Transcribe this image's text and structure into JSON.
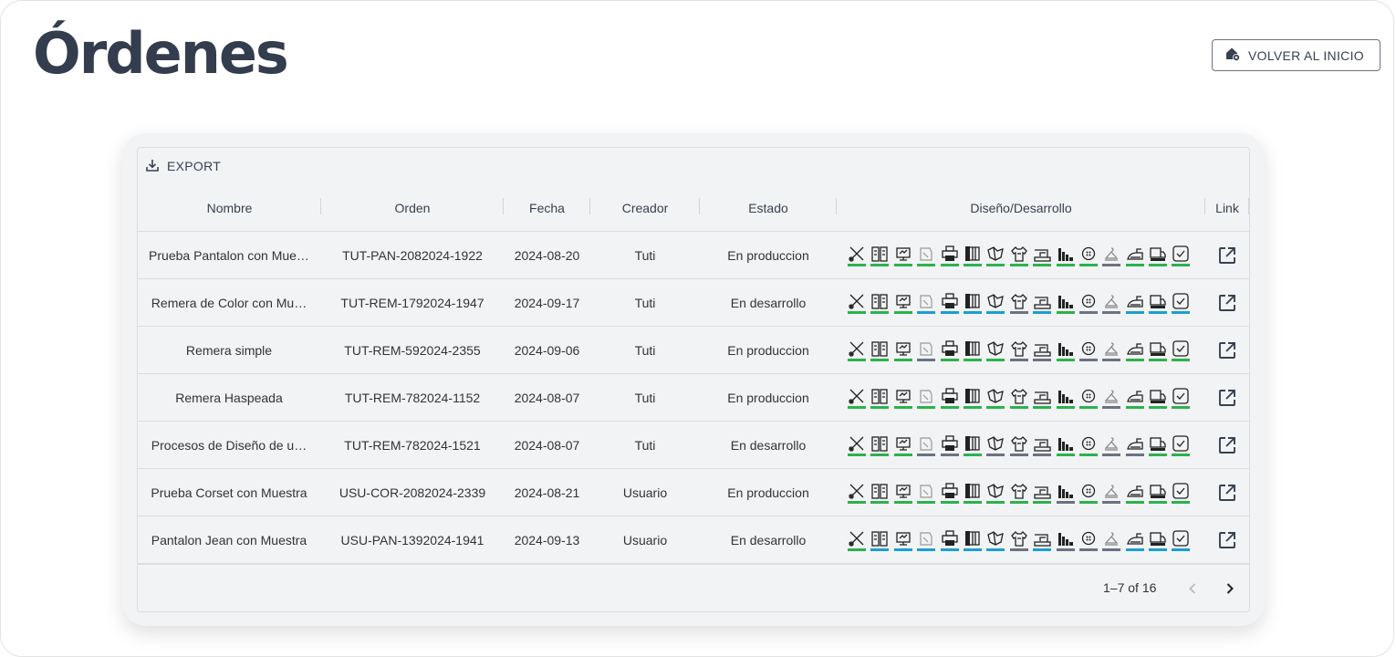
{
  "page": {
    "title": "Órdenes"
  },
  "home_button": {
    "label": "VOLVER AL INICIO",
    "icon": "home-icon"
  },
  "grid": {
    "export_label": "EXPORT",
    "columns": [
      "Nombre",
      "Orden",
      "Fecha",
      "Creador",
      "Estado",
      "Diseño/Desarrollo",
      "Link"
    ],
    "rows": [
      {
        "nombre": "Prueba Pantalon con Mue…",
        "orden": "TUT-PAN-2082024-1922",
        "fecha": "2024-08-20",
        "creador": "Tuti",
        "estado": "En produccion",
        "status": [
          "green",
          "green",
          "green",
          "green",
          "green",
          "green",
          "green",
          "green",
          "green",
          "green",
          "green",
          "grey",
          "green",
          "green",
          "green"
        ]
      },
      {
        "nombre": "Remera de Color con Mu…",
        "orden": "TUT-REM-1792024-1947",
        "fecha": "2024-09-17",
        "creador": "Tuti",
        "estado": "En desarrollo",
        "status": [
          "green",
          "green",
          "green",
          "blue",
          "blue",
          "blue",
          "blue",
          "grey",
          "blue",
          "green",
          "grey",
          "grey",
          "blue",
          "blue",
          "blue"
        ]
      },
      {
        "nombre": "Remera simple",
        "orden": "TUT-REM-592024-2355",
        "fecha": "2024-09-06",
        "creador": "Tuti",
        "estado": "En produccion",
        "status": [
          "green",
          "green",
          "green",
          "grey",
          "green",
          "green",
          "green",
          "grey",
          "grey",
          "green",
          "grey",
          "grey",
          "green",
          "green",
          "green"
        ]
      },
      {
        "nombre": "Remera Haspeada",
        "orden": "TUT-REM-782024-1152",
        "fecha": "2024-08-07",
        "creador": "Tuti",
        "estado": "En produccion",
        "status": [
          "green",
          "green",
          "green",
          "green",
          "green",
          "green",
          "green",
          "green",
          "green",
          "green",
          "green",
          "grey",
          "green",
          "green",
          "green"
        ]
      },
      {
        "nombre": "Procesos de Diseño de u…",
        "orden": "TUT-REM-782024-1521",
        "fecha": "2024-08-07",
        "creador": "Tuti",
        "estado": "En desarrollo",
        "status": [
          "green",
          "green",
          "green",
          "grey",
          "grey",
          "green",
          "grey",
          "grey",
          "grey",
          "green",
          "green",
          "grey",
          "grey",
          "green",
          "green"
        ]
      },
      {
        "nombre": "Prueba Corset con Muestra",
        "orden": "USU-COR-2082024-2339",
        "fecha": "2024-08-21",
        "creador": "Usuario",
        "estado": "En produccion",
        "status": [
          "green",
          "green",
          "green",
          "green",
          "green",
          "green",
          "green",
          "green",
          "green",
          "grey",
          "green",
          "grey",
          "green",
          "green",
          "green"
        ]
      },
      {
        "nombre": "Pantalon Jean con Muestra",
        "orden": "USU-PAN-1392024-1941",
        "fecha": "2024-09-13",
        "creador": "Usuario",
        "estado": "En desarrollo",
        "status": [
          "green",
          "blue",
          "blue",
          "blue",
          "blue",
          "blue",
          "blue",
          "grey",
          "blue",
          "grey",
          "grey",
          "grey",
          "blue",
          "blue",
          "blue"
        ]
      }
    ],
    "process_icons": [
      "cutting-icon",
      "materials-icon",
      "computer-design-icon",
      "sketch-icon",
      "printer-icon",
      "fabric-roll-icon",
      "folding-icon",
      "tshirt-icon",
      "sewing-machine-icon",
      "size-chart-icon",
      "button-icon",
      "hanger-icon",
      "iron-icon",
      "delivery-truck-icon",
      "approved-check-icon"
    ],
    "colors": {
      "green": "#2bb24c",
      "blue": "#1a9fd0",
      "grey": "#6b7280"
    },
    "pagination": {
      "label": "1–7 of 16"
    }
  }
}
